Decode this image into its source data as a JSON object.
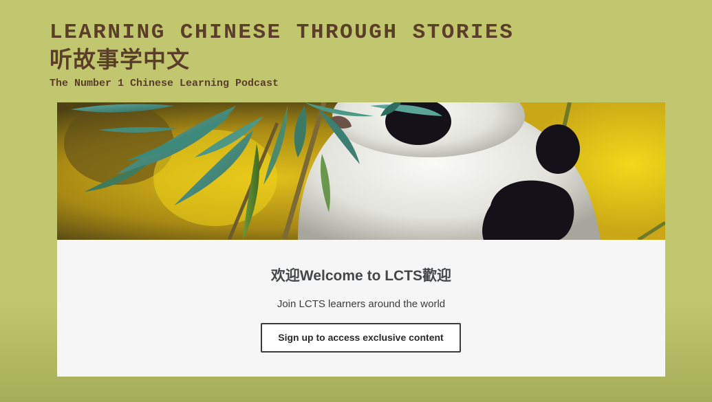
{
  "header": {
    "title": "LEARNING CHINESE THROUGH STORIES",
    "title_cn": "听故事学中文",
    "tagline": "The Number 1 Chinese Learning Podcast"
  },
  "hero": {
    "image_subject": "panda-eating-bamboo"
  },
  "card": {
    "welcome": "欢迎Welcome to LCTS歡迎",
    "subtitle": "Join LCTS learners around the world",
    "cta_label": "Sign up to access exclusive content"
  },
  "colors": {
    "background": "#c1c76e",
    "title_brown": "#5a3e29",
    "card_bg": "#f6f6f6",
    "button_border": "#3a3a3a"
  }
}
